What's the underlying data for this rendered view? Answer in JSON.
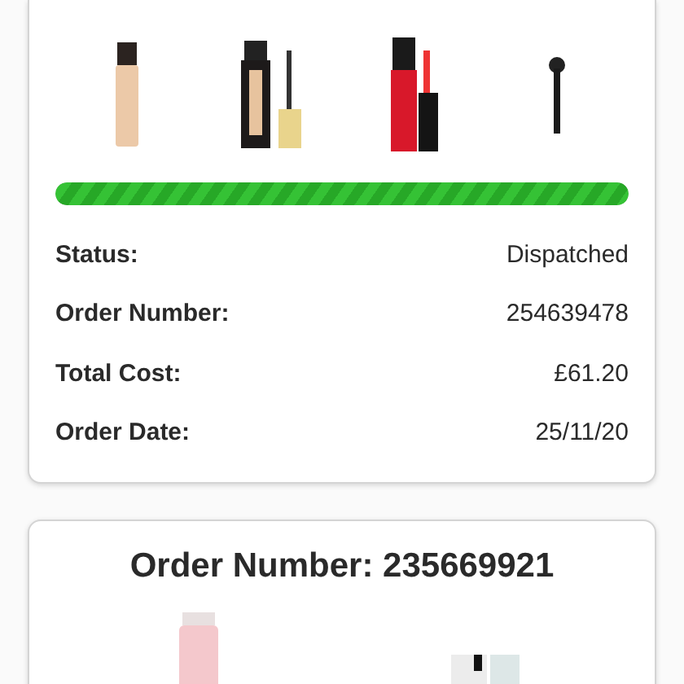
{
  "orders": [
    {
      "progress": {
        "level": 1
      },
      "details": [
        {
          "label": "Status:",
          "value": "Dispatched"
        },
        {
          "label": "Order Number:",
          "value": "254639478"
        },
        {
          "label": "Total Cost:",
          "value": "£61.20"
        },
        {
          "label": "Order Date:",
          "value": "25/11/20"
        }
      ]
    },
    {
      "title": "Order Number: 235669921"
    }
  ]
}
